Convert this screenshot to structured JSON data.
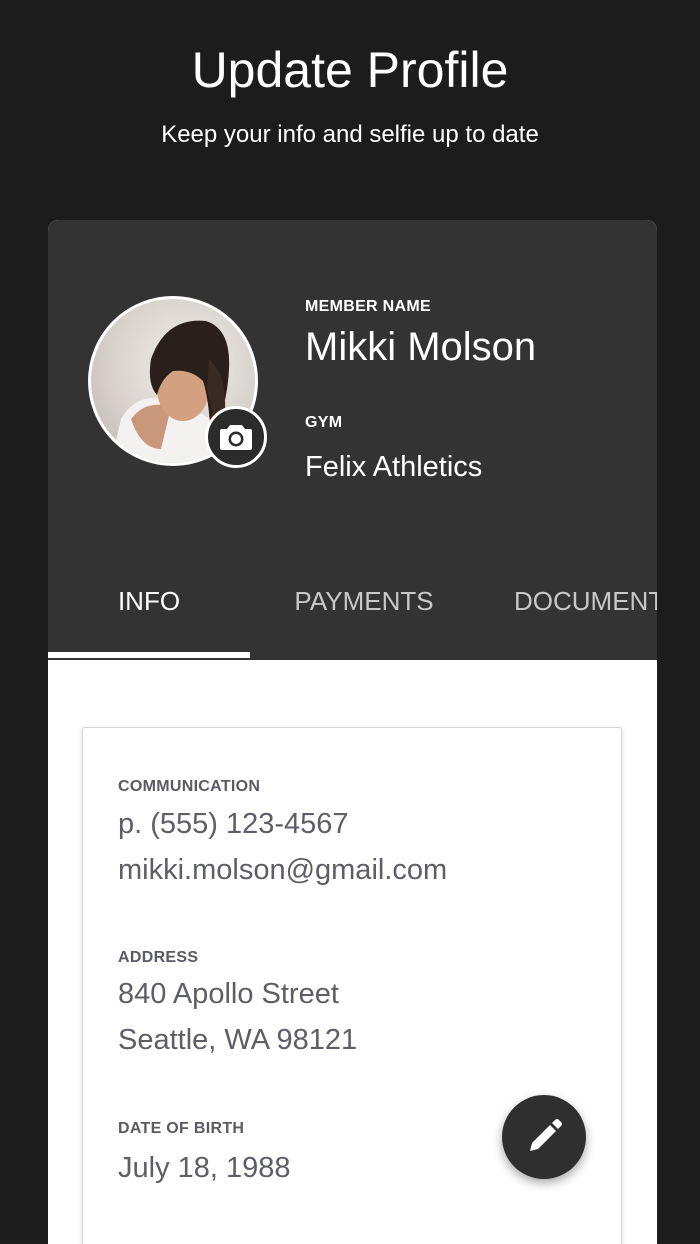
{
  "page": {
    "title": "Update Profile",
    "subtitle": "Keep your info and selfie up to date"
  },
  "profile": {
    "member_name_label": "MEMBER NAME",
    "member_name": "Mikki Molson",
    "gym_label": "GYM",
    "gym_name": "Felix Athletics",
    "avatar_icon": "user-photo",
    "camera_icon": "camera-icon"
  },
  "tabs": [
    {
      "label": "INFO",
      "active": true
    },
    {
      "label": "PAYMENTS",
      "active": false
    },
    {
      "label": "DOCUMENTS",
      "active": false
    }
  ],
  "info": {
    "communication_label": "COMMUNICATION",
    "phone": "p. (555) 123-4567",
    "email": "mikki.molson@gmail.com",
    "address_label": "ADDRESS",
    "address_line1": "840 Apollo Street",
    "address_line2": "Seattle, WA 98121",
    "dob_label": "DATE OF BIRTH",
    "dob": "July 18, 1988"
  },
  "fab": {
    "icon": "pencil-icon"
  },
  "colors": {
    "background": "#1c1c1c",
    "header": "#333333",
    "text_muted": "#5e5e68"
  }
}
